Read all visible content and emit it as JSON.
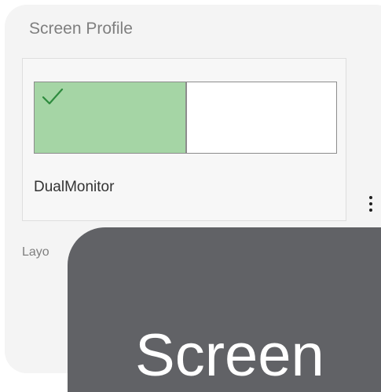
{
  "panel": {
    "title": "Screen Profile",
    "layout_label": "Layo"
  },
  "profile": {
    "name": "DualMonitor",
    "selected": true,
    "monitor_primary_color": "#a5d5a5",
    "monitor_secondary_color": "#ffffff",
    "check_icon": "checkmark-icon"
  },
  "menu": {
    "icon": "kebab-menu-icon"
  },
  "tooltip": {
    "text": "Screen",
    "background": "#616266"
  }
}
